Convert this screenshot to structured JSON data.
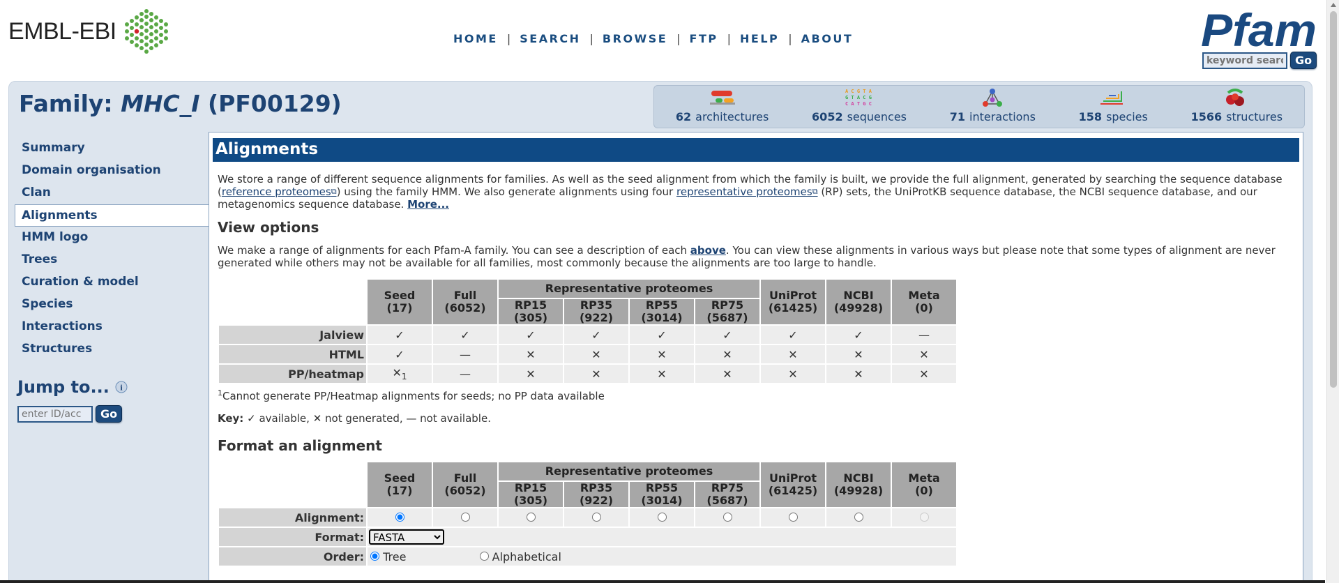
{
  "header": {
    "embl_logo": "EMBL-EBI",
    "nav": [
      "HOME",
      "SEARCH",
      "BROWSE",
      "FTP",
      "HELP",
      "ABOUT"
    ],
    "pfam_logo": "Pfam",
    "keyword_placeholder": "keyword search",
    "go_label": "Go"
  },
  "family": {
    "prefix": "Family: ",
    "name": "MHC_I",
    "accession": " (PF00129)"
  },
  "stats": [
    {
      "count": "62",
      "label": "architectures",
      "icon": "architectures-icon"
    },
    {
      "count": "6052",
      "label": "sequences",
      "icon": "sequences-icon"
    },
    {
      "count": "71",
      "label": "interactions",
      "icon": "interactions-icon"
    },
    {
      "count": "158",
      "label": "species",
      "icon": "species-icon"
    },
    {
      "count": "1566",
      "label": "structures",
      "icon": "structures-icon"
    }
  ],
  "sidebar": {
    "items": [
      "Summary",
      "Domain organisation",
      "Clan",
      "Alignments",
      "HMM logo",
      "Trees",
      "Curation & model",
      "Species",
      "Interactions",
      "Structures"
    ],
    "active": "Alignments",
    "jump_title": "Jump to...",
    "jump_placeholder": "enter ID/acc",
    "go_label": "Go"
  },
  "section_title": "Alignments",
  "intro": {
    "p1": "We store a range of different sequence alignments for families. As well as the seed alignment from which the family is built, we provide the full alignment, generated by searching the sequence database (",
    "link1": "reference proteomes",
    "p2": ") using the family HMM. We also generate alignments using four ",
    "link2": "representative proteomes",
    "p3": " (RP) sets, the UniProtKB sequence database, the NCBI sequence database, and our metagenomics sequence database. ",
    "more": "More..."
  },
  "view_options": {
    "heading": "View options",
    "p1": "We make a range of alignments for each Pfam-A family. You can see a description of each ",
    "above": "above",
    "p2": ". You can view these alignments in various ways but please note that some types of alignment are never generated while others may not be available for all families, most commonly because the alignments are too large to handle."
  },
  "columns": {
    "seed": [
      "Seed",
      "(17)"
    ],
    "full": [
      "Full",
      "(6052)"
    ],
    "rp_group": "Representative proteomes",
    "rp15": [
      "RP15",
      "(305)"
    ],
    "rp35": [
      "RP35",
      "(922)"
    ],
    "rp55": [
      "RP55",
      "(3014)"
    ],
    "rp75": [
      "RP75",
      "(5687)"
    ],
    "uniprot": [
      "UniProt",
      "(61425)"
    ],
    "ncbi": [
      "NCBI",
      "(49928)"
    ],
    "meta": [
      "Meta",
      "(0)"
    ]
  },
  "view_rows": [
    {
      "label": "Jalview",
      "cells": [
        "✓",
        "✓",
        "✓",
        "✓",
        "✓",
        "✓",
        "✓",
        "✓",
        "—"
      ]
    },
    {
      "label": "HTML",
      "cells": [
        "✓",
        "—",
        "✕",
        "✕",
        "✕",
        "✕",
        "✕",
        "✕",
        "✕"
      ]
    },
    {
      "label": "PP/heatmap",
      "cells": [
        "✕",
        "—",
        "✕",
        "✕",
        "✕",
        "✕",
        "✕",
        "✕",
        "✕"
      ],
      "seed_footnote": "1"
    }
  ],
  "footnote": {
    "marker": "1",
    "text": "Cannot generate PP/Heatmap alignments for seeds; no PP data available"
  },
  "key": {
    "label": "Key:",
    "check": "✓",
    "available": " available, ",
    "cross": "✕",
    "not_generated": " not generated, ",
    "dash": "—",
    "not_available": " not available."
  },
  "format_section": {
    "heading": "Format an alignment",
    "alignment_label": "Alignment:",
    "format_label": "Format:",
    "format_value": "FASTA",
    "order_label": "Order:",
    "order_tree": "Tree",
    "order_alpha": "Alphabetical"
  }
}
